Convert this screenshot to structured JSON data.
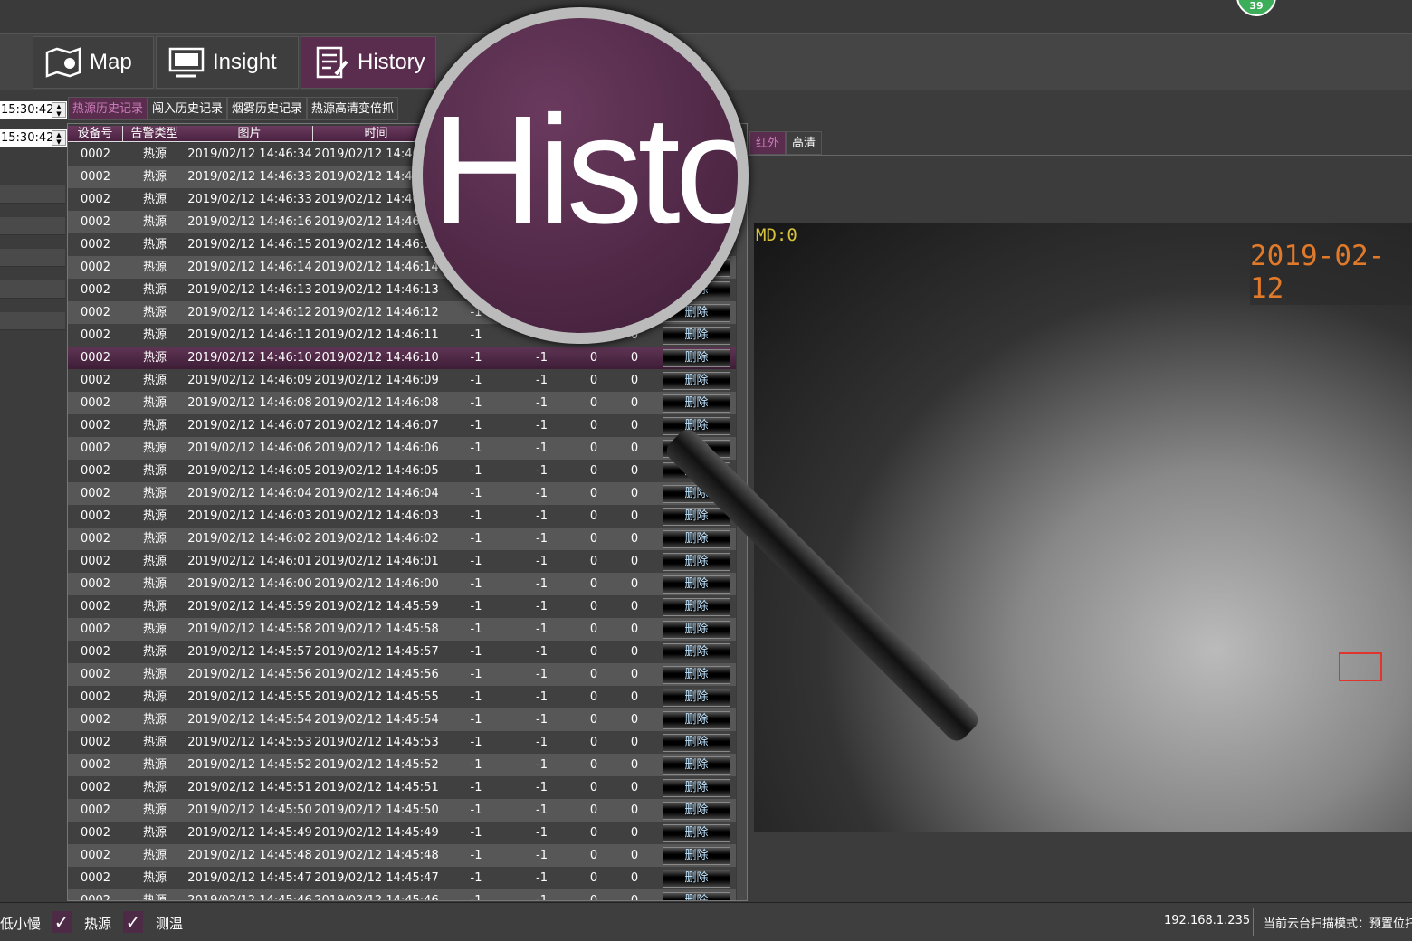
{
  "top": {
    "badge": "39"
  },
  "nav": [
    {
      "label": "Map",
      "icon": "map-icon"
    },
    {
      "label": "Insight",
      "icon": "monitor-icon"
    },
    {
      "label": "History",
      "icon": "history-icon",
      "selected": true
    }
  ],
  "time_inputs": [
    "15:30:42",
    "15:30:42"
  ],
  "subtabs": [
    {
      "label": "热源历史记录",
      "selected": true
    },
    {
      "label": "闯入历史记录"
    },
    {
      "label": "烟雾历史记录"
    },
    {
      "label": "热源高清变倍抓"
    }
  ],
  "columns": [
    "设备号",
    "告警类型",
    "图片",
    "时间"
  ],
  "delete_label": "删除",
  "selected_row": "2019/02/12 14:46:10",
  "rows": [
    "14:46:34",
    "14:46:33",
    "14:46:33",
    "14:46:16",
    "14:46:15",
    "14:46:14",
    "14:46:13",
    "14:46:12",
    "14:46:11",
    "14:46:10",
    "14:46:09",
    "14:46:08",
    "14:46:07",
    "14:46:06",
    "14:46:05",
    "14:46:04",
    "14:46:03",
    "14:46:02",
    "14:46:01",
    "14:46:00",
    "14:45:59",
    "14:45:58",
    "14:45:57",
    "14:45:56",
    "14:45:55",
    "14:45:54",
    "14:45:53",
    "14:45:52",
    "14:45:51",
    "14:45:50",
    "14:45:49",
    "14:45:48",
    "14:45:47",
    "14:45:46"
  ],
  "row_common": {
    "device": "0002",
    "type": "热源",
    "date": "2019/02/12",
    "v1": "-1",
    "v2": "-1",
    "v3": "0",
    "v4": "0"
  },
  "right_tabs": [
    {
      "label": "红外",
      "selected": true
    },
    {
      "label": "高清"
    }
  ],
  "video": {
    "md": "MD:0",
    "timestamp": "2019-02-12"
  },
  "magnifier_text": "Histo",
  "status": {
    "items": [
      "低小慢",
      "热源",
      "测温"
    ],
    "ip": "192.168.1.235",
    "mode": "当前云台扫描模式：预置位扫"
  },
  "colors": {
    "accent": "#5a2d4f",
    "badge": "#3cae5a",
    "delete_text": "#bfe4ff"
  }
}
